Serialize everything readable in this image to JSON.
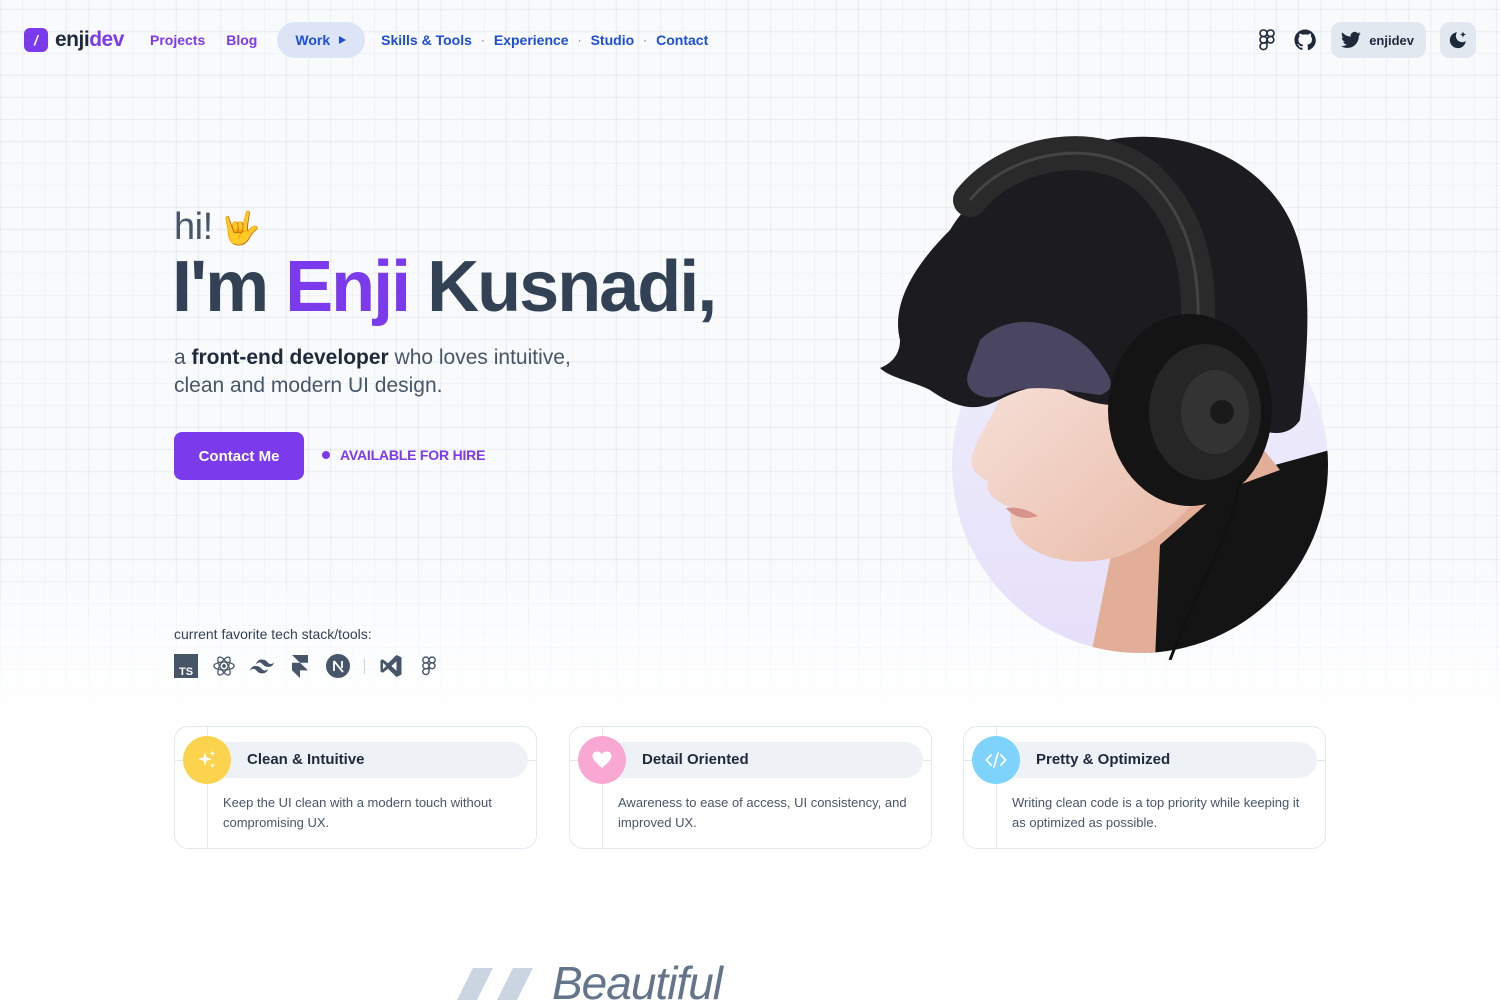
{
  "brand": {
    "logo_mark": "/",
    "name_part1": "enji",
    "name_part2": "dev"
  },
  "nav": {
    "projects": "Projects",
    "blog": "Blog",
    "work": "Work",
    "skills": "Skills & Tools",
    "experience": "Experience",
    "studio": "Studio",
    "contact": "Contact",
    "separator": "·"
  },
  "header_right": {
    "twitter_handle": "enjidev",
    "icons": [
      "figma-icon",
      "github-icon",
      "twitter-icon",
      "theme-toggle-icon"
    ]
  },
  "hero": {
    "greeting": "hi!",
    "greeting_emoji": "🤟",
    "name_prefix": "I'm ",
    "name_first": "Enji",
    "name_last": " Kusnadi,",
    "desc_a": "a ",
    "desc_bold": "front-end developer",
    "desc_rest": " who loves intuitive, clean and modern UI design.",
    "cta": "Contact Me",
    "availability": "AVAILABLE FOR HIRE"
  },
  "stack": {
    "label": "current favorite tech stack/tools:",
    "items": [
      "typescript-icon",
      "react-icon",
      "tailwind-icon",
      "framer-icon",
      "nextjs-icon",
      "vscode-icon",
      "figma-icon"
    ]
  },
  "features": [
    {
      "title": "Clean & Intuitive",
      "desc": "Keep the UI clean with a modern touch without compromising UX.",
      "icon": "sparkles-icon",
      "color": "#fcd34d"
    },
    {
      "title": "Detail Oriented",
      "desc": "Awareness to ease of access, UI consistency, and improved UX.",
      "icon": "heart-icon",
      "color": "#f9a8d4"
    },
    {
      "title": "Pretty & Optimized",
      "desc": "Writing clean code is a top priority while keeping it as optimized as possible.",
      "icon": "code-icon",
      "color": "#7dd3fc"
    }
  ],
  "teaser": {
    "text": "Beautiful"
  },
  "colors": {
    "accent": "#7c3aed",
    "nav_blue": "#1d4ed8",
    "text_dark": "#334155"
  }
}
